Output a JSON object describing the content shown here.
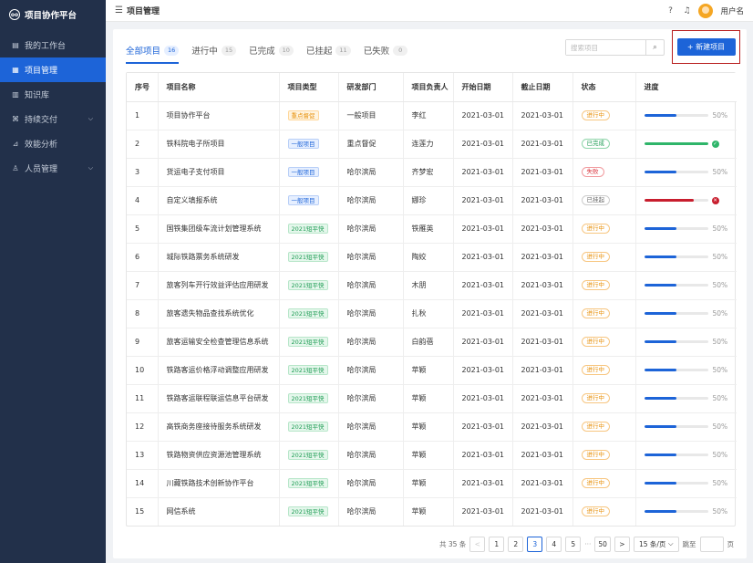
{
  "app": {
    "title": "项目协作平台",
    "logo_glyph": "oo"
  },
  "sidebar": {
    "items": [
      {
        "name": "workbench",
        "label": "我的工作台",
        "icon": "calendar-icon",
        "glyph": "▤",
        "active": false,
        "expandable": false
      },
      {
        "name": "project-mgmt",
        "label": "项目管理",
        "icon": "grid-icon",
        "glyph": "▦",
        "active": true,
        "expandable": false
      },
      {
        "name": "knowledge",
        "label": "知识库",
        "icon": "book-icon",
        "glyph": "▥",
        "active": false,
        "expandable": false
      },
      {
        "name": "delivery",
        "label": "持续交付",
        "icon": "command-icon",
        "glyph": "⌘",
        "active": false,
        "expandable": true
      },
      {
        "name": "analytics",
        "label": "效能分析",
        "icon": "chart-icon",
        "glyph": "⊿",
        "active": false,
        "expandable": false
      },
      {
        "name": "people",
        "label": "人员管理",
        "icon": "user-icon",
        "glyph": "♙",
        "active": false,
        "expandable": true
      }
    ]
  },
  "header": {
    "title": "项目管理",
    "menu_glyph": "☰",
    "help_glyph": "?",
    "bell_glyph": "♫",
    "username": "用户名"
  },
  "tabs": [
    {
      "label": "全部项目",
      "count": "16",
      "active": true
    },
    {
      "label": "进行中",
      "count": "15",
      "active": false
    },
    {
      "label": "已完成",
      "count": "10",
      "active": false
    },
    {
      "label": "已挂起",
      "count": "11",
      "active": false
    },
    {
      "label": "已失败",
      "count": "0",
      "active": false
    }
  ],
  "search": {
    "placeholder": "搜索项目",
    "value": "",
    "glyph": "⌕"
  },
  "new_button": {
    "label": "+ 新建项目"
  },
  "table": {
    "columns": [
      "序号",
      "项目名称",
      "项目类型",
      "研发部门",
      "项目负责人",
      "开始日期",
      "截止日期",
      "状态",
      "进度"
    ],
    "rows": [
      {
        "no": "1",
        "name": "项目协作平台",
        "type": "重点督促",
        "type_style": "orange",
        "dept": "一般项目",
        "owner": "李红",
        "start": "2021-03-01",
        "end": "2021-03-01",
        "status": "进行中",
        "status_style": "run",
        "progress": 0.5,
        "progress_label": "50%",
        "progress_mark": ""
      },
      {
        "no": "2",
        "name": "铁科院电子所项目",
        "type": "一般项目",
        "type_style": "blue",
        "dept": "重点督促",
        "owner": "连莲力",
        "start": "2021-03-01",
        "end": "2021-03-01",
        "status": "已完成",
        "status_style": "done",
        "progress": 1.0,
        "progress_label": "",
        "progress_mark": "✓"
      },
      {
        "no": "3",
        "name": "货运电子支付项目",
        "type": "一般项目",
        "type_style": "blue",
        "dept": "哈尔滨局",
        "owner": "齐梦宏",
        "start": "2021-03-01",
        "end": "2021-03-01",
        "status": "失败",
        "status_style": "fail",
        "progress": 0.5,
        "progress_label": "50%",
        "progress_mark": ""
      },
      {
        "no": "4",
        "name": "自定义填报系统",
        "type": "一般项目",
        "type_style": "blue",
        "dept": "哈尔滨局",
        "owner": "娜珍",
        "start": "2021-03-01",
        "end": "2021-03-01",
        "status": "已挂起",
        "status_style": "hang",
        "progress": 0.78,
        "progress_label": "",
        "progress_mark": "✕"
      },
      {
        "no": "5",
        "name": "国铁集团级车流计划管理系统",
        "type": "2021短平快",
        "type_style": "green",
        "dept": "哈尔滨局",
        "owner": "铁雁英",
        "start": "2021-03-01",
        "end": "2021-03-01",
        "status": "进行中",
        "status_style": "run",
        "progress": 0.5,
        "progress_label": "50%",
        "progress_mark": ""
      },
      {
        "no": "6",
        "name": "城际铁路票务系统研发",
        "type": "2021短平快",
        "type_style": "green",
        "dept": "哈尔滨局",
        "owner": "陶姣",
        "start": "2021-03-01",
        "end": "2021-03-01",
        "status": "进行中",
        "status_style": "run",
        "progress": 0.5,
        "progress_label": "50%",
        "progress_mark": ""
      },
      {
        "no": "7",
        "name": "旅客列车开行效益评估应用研发",
        "type": "2021短平快",
        "type_style": "green",
        "dept": "哈尔滨局",
        "owner": "木朋",
        "start": "2021-03-01",
        "end": "2021-03-01",
        "status": "进行中",
        "status_style": "run",
        "progress": 0.5,
        "progress_label": "50%",
        "progress_mark": ""
      },
      {
        "no": "8",
        "name": "旅客遗失物品查找系统优化",
        "type": "2021短平快",
        "type_style": "green",
        "dept": "哈尔滨局",
        "owner": "扎秋",
        "start": "2021-03-01",
        "end": "2021-03-01",
        "status": "进行中",
        "status_style": "run",
        "progress": 0.5,
        "progress_label": "50%",
        "progress_mark": ""
      },
      {
        "no": "9",
        "name": "旅客运输安全检查管理信息系统",
        "type": "2021短平快",
        "type_style": "green",
        "dept": "哈尔滨局",
        "owner": "白韵蓓",
        "start": "2021-03-01",
        "end": "2021-03-01",
        "status": "进行中",
        "status_style": "run",
        "progress": 0.5,
        "progress_label": "50%",
        "progress_mark": ""
      },
      {
        "no": "10",
        "name": "铁路客运价格浮动调整应用研发",
        "type": "2021短平快",
        "type_style": "green",
        "dept": "哈尔滨局",
        "owner": "苹颖",
        "start": "2021-03-01",
        "end": "2021-03-01",
        "status": "进行中",
        "status_style": "run",
        "progress": 0.5,
        "progress_label": "50%",
        "progress_mark": ""
      },
      {
        "no": "11",
        "name": "铁路客运联程联运信息平台研发",
        "type": "2021短平快",
        "type_style": "green",
        "dept": "哈尔滨局",
        "owner": "苹颖",
        "start": "2021-03-01",
        "end": "2021-03-01",
        "status": "进行中",
        "status_style": "run",
        "progress": 0.5,
        "progress_label": "50%",
        "progress_mark": ""
      },
      {
        "no": "12",
        "name": "高铁商务座接待服务系统研发",
        "type": "2021短平快",
        "type_style": "green",
        "dept": "哈尔滨局",
        "owner": "苹颖",
        "start": "2021-03-01",
        "end": "2021-03-01",
        "status": "进行中",
        "status_style": "run",
        "progress": 0.5,
        "progress_label": "50%",
        "progress_mark": ""
      },
      {
        "no": "13",
        "name": "铁路物资供应资源池管理系统",
        "type": "2021短平快",
        "type_style": "green",
        "dept": "哈尔滨局",
        "owner": "苹颖",
        "start": "2021-03-01",
        "end": "2021-03-01",
        "status": "进行中",
        "status_style": "run",
        "progress": 0.5,
        "progress_label": "50%",
        "progress_mark": ""
      },
      {
        "no": "14",
        "name": "川藏铁路技术创新协作平台",
        "type": "2021短平快",
        "type_style": "green",
        "dept": "哈尔滨局",
        "owner": "苹颖",
        "start": "2021-03-01",
        "end": "2021-03-01",
        "status": "进行中",
        "status_style": "run",
        "progress": 0.5,
        "progress_label": "50%",
        "progress_mark": ""
      },
      {
        "no": "15",
        "name": "网信系统",
        "type": "2021短平快",
        "type_style": "green",
        "dept": "哈尔滨局",
        "owner": "苹颖",
        "start": "2021-03-01",
        "end": "2021-03-01",
        "status": "进行中",
        "status_style": "run",
        "progress": 0.5,
        "progress_label": "50%",
        "progress_mark": ""
      }
    ]
  },
  "pagination": {
    "total_label": "共 35 条",
    "prev_glyph": "<",
    "next_glyph": ">",
    "pages": [
      "1",
      "2",
      "3",
      "4",
      "5"
    ],
    "current": "3",
    "ellipsis": "···",
    "last_page": "50",
    "page_size": "15 条/页",
    "jump_label": "跳至",
    "jump_value": "",
    "page_suffix": "页"
  },
  "colors": {
    "accent": "#1d64d8",
    "progress_blue": "#1d64d8",
    "progress_green": "#2fb56a",
    "progress_red": "#c81e2e",
    "highlight_border": "#b81d1d"
  }
}
